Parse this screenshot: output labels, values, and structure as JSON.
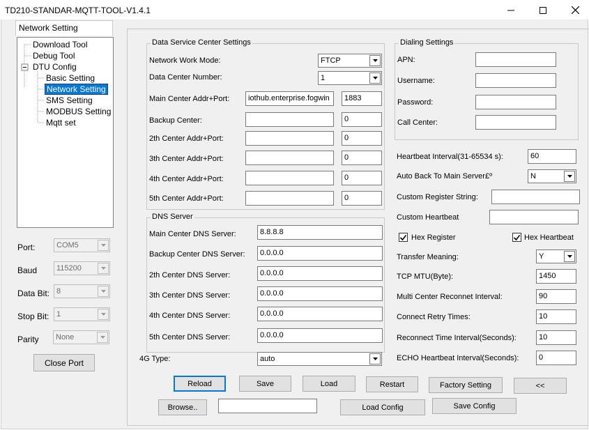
{
  "window": {
    "title": "TD210-STANDAR-MQTT-TOOL-V1.4.1"
  },
  "left": {
    "tab_label": "Network Setting",
    "tree": [
      {
        "label": "Download Tool"
      },
      {
        "label": "Debug Tool"
      },
      {
        "label": "DTU Config",
        "toggle": "⊟"
      },
      {
        "label": "Basic Setting"
      },
      {
        "label": "Network Setting"
      },
      {
        "label": "SMS Setting"
      },
      {
        "label": "MODBUS Setting"
      },
      {
        "label": "Mqtt set"
      }
    ],
    "port": {
      "label": "Port:",
      "value": "COM5"
    },
    "baud": {
      "label": "Baud",
      "value": "115200"
    },
    "databit": {
      "label": "Data Bit:",
      "value": "8"
    },
    "stopbit": {
      "label": "Stop Bit:",
      "value": "1"
    },
    "parity": {
      "label": "Parity",
      "value": "None"
    },
    "close_port": "Close Port"
  },
  "dsc": {
    "title": "Data Service Center Settings",
    "work_mode": {
      "label": "Network Work Mode:",
      "value": "FTCP"
    },
    "center_number": {
      "label": "Data Center Number:",
      "value": "1"
    },
    "main_center": {
      "label": "Main Center Addr+Port:",
      "addr": "iothub.enterprise.fogwin",
      "port": "1883"
    },
    "backup_center": {
      "label": "Backup Center:",
      "addr": "",
      "port": "0"
    },
    "center2": {
      "label": "2th Center Addr+Port:",
      "addr": "",
      "port": "0"
    },
    "center3": {
      "label": "3th Center Addr+Port:",
      "addr": "",
      "port": "0"
    },
    "center4": {
      "label": "4th Center Addr+Port:",
      "addr": "",
      "port": "0"
    },
    "center5": {
      "label": "5th Center Addr+Port:",
      "addr": "",
      "port": "0"
    }
  },
  "dns": {
    "title": "DNS Server",
    "main": {
      "label": "Main Center DNS Server:",
      "value": "8.8.8.8"
    },
    "backup": {
      "label": "Backup Center DNS Server:",
      "value": "0.0.0.0"
    },
    "dns2": {
      "label": "2th Center DNS Server:",
      "value": "0.0.0.0"
    },
    "dns3": {
      "label": "3th Center DNS Server:",
      "value": "0.0.0.0"
    },
    "dns4": {
      "label": "4th Center DNS Server:",
      "value": "0.0.0.0"
    },
    "dns5": {
      "label": "5th Center DNS Server:",
      "value": "0.0.0.0"
    }
  },
  "g4": {
    "label": "4G Type:",
    "value": "auto"
  },
  "dialing": {
    "title": "Dialing Settings",
    "apn": {
      "label": "APN:",
      "value": ""
    },
    "username": {
      "label": "Username:",
      "value": ""
    },
    "password": {
      "label": "Password:",
      "value": ""
    },
    "call_center": {
      "label": "Call Center:",
      "value": ""
    }
  },
  "right": {
    "heartbeat_interval": {
      "label": "Heartbeat Interval(31-65534 s):",
      "value": "60"
    },
    "auto_back": {
      "label": "Auto Back To Main Server£º",
      "value": "N"
    },
    "custom_register": {
      "label": "Custom Register String:",
      "value": ""
    },
    "custom_heartbeat": {
      "label": "Custom Heartbeat",
      "value": ""
    },
    "hex_register": {
      "label": "Hex Register",
      "checked": true
    },
    "hex_heartbeat": {
      "label": "Hex Heartbeat",
      "checked": true
    },
    "transfer_meaning": {
      "label": "Transfer Meaning:",
      "value": "Y"
    },
    "tcp_mtu": {
      "label": "TCP MTU(Byte):",
      "value": "1450"
    },
    "multi_reconnect": {
      "label": "Multi Center Reconnet Interval:",
      "value": "90"
    },
    "retry_times": {
      "label": "Connect Retry Times:",
      "value": "10"
    },
    "reconnect_time": {
      "label": "Reconnect Time Interval(Seconds):",
      "value": "10"
    },
    "echo_heartbeat": {
      "label": "ECHO Heartbeat Interval(Seconds):",
      "value": "0"
    }
  },
  "buttons": {
    "reload": "Reload",
    "save": "Save",
    "load": "Load",
    "restart": "Restart",
    "factory": "Factory Setting",
    "back": "<<",
    "browse": "Browse..",
    "browse_path": "",
    "load_config": "Load Config",
    "save_config": "Save Config"
  }
}
